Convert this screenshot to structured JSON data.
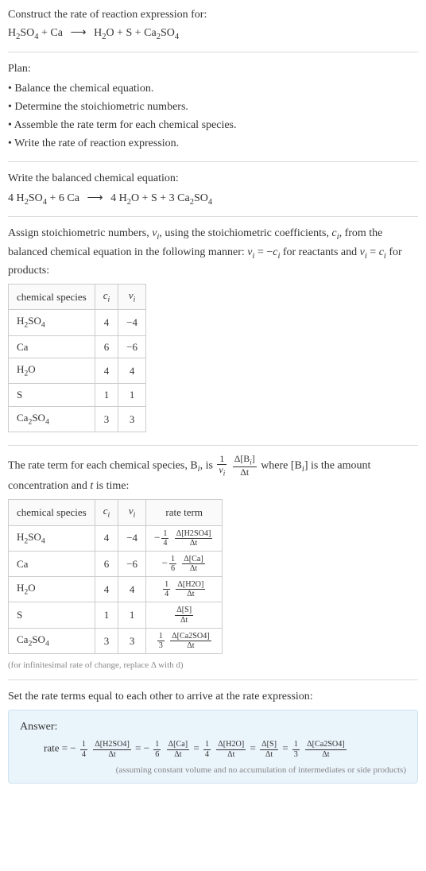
{
  "intro": {
    "text": "Construct the rate of reaction expression for:",
    "eq_lhs_1": "H",
    "eq_lhs_1b": "SO",
    "eq_plus": " + Ca",
    "eq_arrow": "⟶",
    "eq_rhs": " H",
    "eq_rhs_b": "O + S + Ca",
    "eq_rhs_c": "SO"
  },
  "plan": {
    "title": "Plan:",
    "items": [
      "• Balance the chemical equation.",
      "• Determine the stoichiometric numbers.",
      "• Assemble the rate term for each chemical species.",
      "• Write the rate of reaction expression."
    ]
  },
  "balanced": {
    "title": "Write the balanced chemical equation:",
    "prefix1": "4 H",
    "prefix2": "SO",
    "mid": " + 6 Ca  ",
    "arrow": "⟶",
    "rhs1": "  4 H",
    "rhs2": "O + S + 3 Ca",
    "rhs3": "SO"
  },
  "assign": {
    "par1a": "Assign stoichiometric numbers, ",
    "nu_i": "ν",
    "par1b": ", using the stoichiometric coefficients, ",
    "c_i": "c",
    "par1c": ", from the balanced chemical equation in the following manner: ",
    "rel1": " = −",
    "par1d": " for reactants and ",
    "rel2": " = ",
    "par1e": " for products:"
  },
  "table1": {
    "header": [
      "chemical species",
      "cᵢ",
      "νᵢ"
    ],
    "rows": [
      {
        "species_prefix": "H",
        "species_sub1": "2",
        "species_mid": "SO",
        "species_sub2": "4",
        "ci": "4",
        "vi": "−4"
      },
      {
        "species_prefix": "Ca",
        "species_sub1": "",
        "species_mid": "",
        "species_sub2": "",
        "ci": "6",
        "vi": "−6"
      },
      {
        "species_prefix": "H",
        "species_sub1": "2",
        "species_mid": "O",
        "species_sub2": "",
        "ci": "4",
        "vi": "4"
      },
      {
        "species_prefix": "S",
        "species_sub1": "",
        "species_mid": "",
        "species_sub2": "",
        "ci": "1",
        "vi": "1"
      },
      {
        "species_prefix": "Ca",
        "species_sub1": "2",
        "species_mid": "SO",
        "species_sub2": "4",
        "ci": "3",
        "vi": "3"
      }
    ]
  },
  "rateterm": {
    "par_a": "The rate term for each chemical species, B",
    "par_b": ", is ",
    "frac1_num": "1",
    "frac1_den_sym": "ν",
    "frac2_num_a": "Δ[B",
    "frac2_num_b": "]",
    "frac2_den": "Δt",
    "par_c": " where [B",
    "par_d": "] is the amount concentration and ",
    "t": "t",
    "par_e": " is time:"
  },
  "table2": {
    "header": [
      "chemical species",
      "cᵢ",
      "νᵢ",
      "rate term"
    ],
    "rows": [
      {
        "species_prefix": "H",
        "species_sub1": "2",
        "species_mid": "SO",
        "species_sub2": "4",
        "ci": "4",
        "vi": "−4",
        "neg": "−",
        "coef_num": "1",
        "coef_den": "4",
        "dnum": "Δ[H2SO4]",
        "dden": "Δt"
      },
      {
        "species_prefix": "Ca",
        "species_sub1": "",
        "species_mid": "",
        "species_sub2": "",
        "ci": "6",
        "vi": "−6",
        "neg": "−",
        "coef_num": "1",
        "coef_den": "6",
        "dnum": "Δ[Ca]",
        "dden": "Δt"
      },
      {
        "species_prefix": "H",
        "species_sub1": "2",
        "species_mid": "O",
        "species_sub2": "",
        "ci": "4",
        "vi": "4",
        "neg": "",
        "coef_num": "1",
        "coef_den": "4",
        "dnum": "Δ[H2O]",
        "dden": "Δt"
      },
      {
        "species_prefix": "S",
        "species_sub1": "",
        "species_mid": "",
        "species_sub2": "",
        "ci": "1",
        "vi": "1",
        "neg": "",
        "coef_num": "",
        "coef_den": "",
        "dnum": "Δ[S]",
        "dden": "Δt"
      },
      {
        "species_prefix": "Ca",
        "species_sub1": "2",
        "species_mid": "SO",
        "species_sub2": "4",
        "ci": "3",
        "vi": "3",
        "neg": "",
        "coef_num": "1",
        "coef_den": "3",
        "dnum": "Δ[Ca2SO4]",
        "dden": "Δt"
      }
    ],
    "note": "(for infinitesimal rate of change, replace Δ with d)"
  },
  "setequal": {
    "text": "Set the rate terms equal to each other to arrive at the rate expression:"
  },
  "answer": {
    "label": "Answer:",
    "rate_eq_prefix": "rate = −",
    "terms": [
      {
        "neg": "",
        "coef_num": "1",
        "coef_den": "4",
        "dnum": "Δ[H2SO4]",
        "dden": "Δt",
        "after": " = −"
      },
      {
        "neg": "",
        "coef_num": "1",
        "coef_den": "6",
        "dnum": "Δ[Ca]",
        "dden": "Δt",
        "after": " = "
      },
      {
        "neg": "",
        "coef_num": "1",
        "coef_den": "4",
        "dnum": "Δ[H2O]",
        "dden": "Δt",
        "after": " = "
      },
      {
        "neg": "",
        "coef_num": "",
        "coef_den": "",
        "dnum": "Δ[S]",
        "dden": "Δt",
        "after": " = "
      },
      {
        "neg": "",
        "coef_num": "1",
        "coef_den": "3",
        "dnum": "Δ[Ca2SO4]",
        "dden": "Δt",
        "after": ""
      }
    ],
    "note": "(assuming constant volume and no accumulation of intermediates or side products)"
  },
  "i_sub": "i",
  "two": "2",
  "four": "4"
}
